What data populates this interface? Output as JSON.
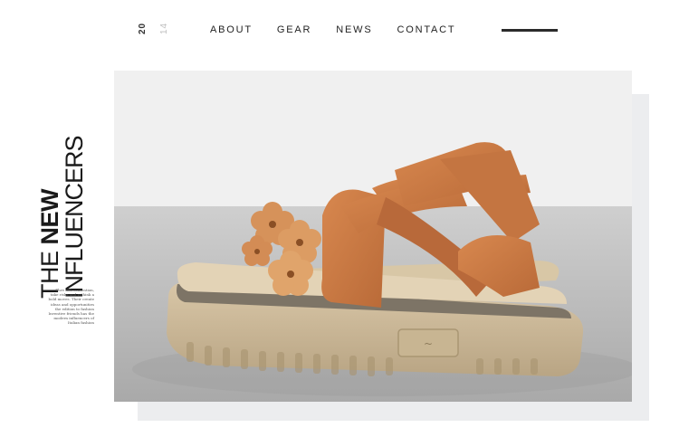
{
  "year": {
    "first": "20",
    "second": "14"
  },
  "nav": {
    "items": [
      {
        "label": "ABOUT"
      },
      {
        "label": "GEAR"
      },
      {
        "label": "NEWS"
      },
      {
        "label": "CONTACT"
      }
    ]
  },
  "headline": {
    "line1_regular": "THE ",
    "line1_bold": "NEW",
    "line2": "INFLUENCERS"
  },
  "blurb": {
    "lines": [
      "Thre deli contention,",
      "take risks and rethink a",
      "bold moves. Their create",
      "ideas and opportunities",
      "the edition to fashion",
      "Inventive friends has the",
      "modern influencers of",
      "Italian fashion"
    ]
  },
  "product": {
    "image_subject": "orange suede flower platform sandals",
    "sole_logo": "goya-logo"
  },
  "colors": {
    "nav_text": "#222222",
    "accent_line": "#2b2b2b",
    "suede": "#c87a45",
    "sole": "#cbb89a"
  }
}
